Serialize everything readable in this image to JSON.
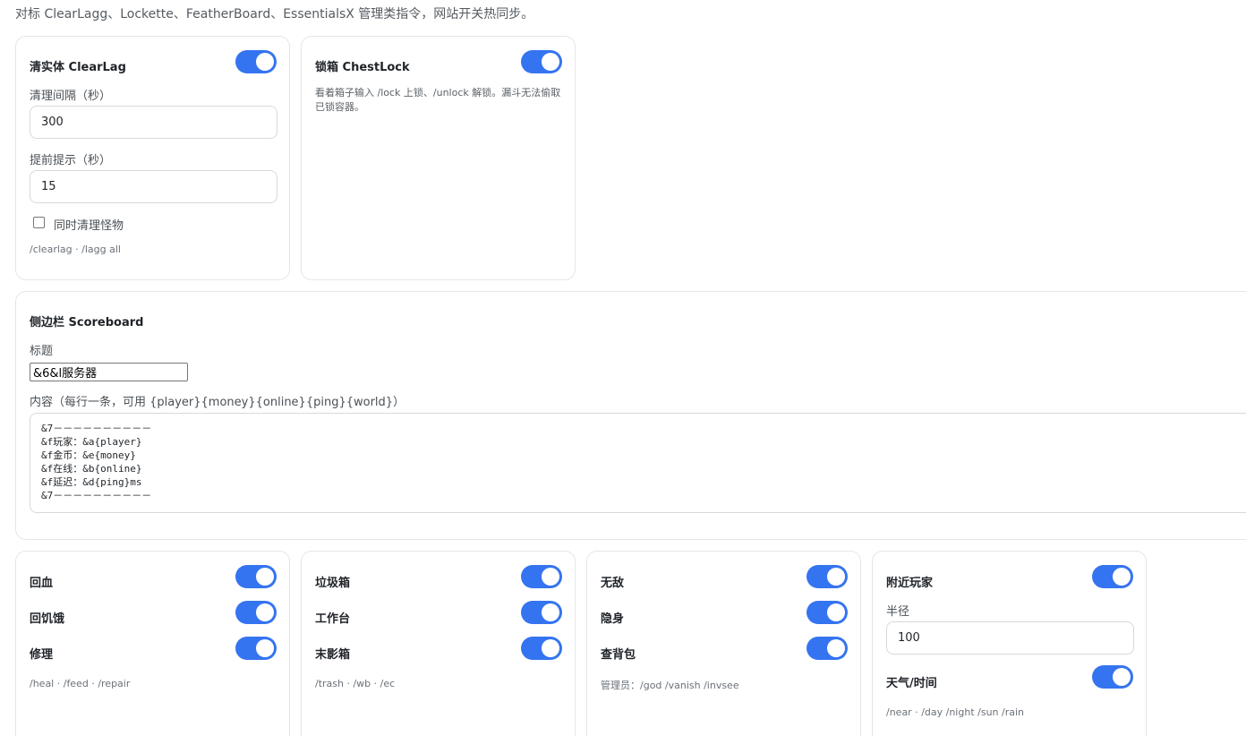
{
  "intro_text": "对标 ClearLagg、Lockette、FeatherBoard、EssentialsX 管理类指令，网站开关热同步。",
  "clearlag": {
    "title": "清实体 ClearLag",
    "enabled": true,
    "interval_label": "清理间隔（秒）",
    "interval_value": "300",
    "warn_label": "提前提示（秒）",
    "warn_value": "15",
    "monsters_label": "同时清理怪物",
    "monsters_checked": false,
    "commands": "/clearlag · /lagg all"
  },
  "chestlock": {
    "title": "锁箱 ChestLock",
    "enabled": true,
    "description": "看着箱子输入 /lock 上锁、/unlock 解锁。漏斗无法偷取已锁容器。"
  },
  "scoreboard": {
    "title": "侧边栏 Scoreboard",
    "title_label": "标题",
    "title_value": "&6&l服务器",
    "content_label": "内容（每行一条，可用 {player}{money}{online}{ping}{world}）",
    "content_lines": [
      "&7－－－－－－－－－－",
      "&f玩家：&a{player}",
      "&f金币：&e{money}",
      "&f在线：&b{online}",
      "&f延迟：&d{ping}ms",
      "&7－－－－－－－－－－"
    ]
  },
  "heal_card": {
    "items": [
      {
        "label": "回血",
        "enabled": true
      },
      {
        "label": "回饥饿",
        "enabled": true
      },
      {
        "label": "修理",
        "enabled": true
      }
    ],
    "commands": "/heal · /feed · /repair"
  },
  "utility_card": {
    "items": [
      {
        "label": "垃圾箱",
        "enabled": true
      },
      {
        "label": "工作台",
        "enabled": true
      },
      {
        "label": "末影箱",
        "enabled": true
      }
    ],
    "commands": "/trash · /wb · /ec"
  },
  "admin_card": {
    "items": [
      {
        "label": "无敌",
        "enabled": true
      },
      {
        "label": "隐身",
        "enabled": true
      },
      {
        "label": "查背包",
        "enabled": true
      }
    ],
    "commands": "管理员：/god /vanish /invsee"
  },
  "nearby_card": {
    "nearby_label": "附近玩家",
    "nearby_enabled": true,
    "radius_label": "半径",
    "radius_value": "100",
    "weather_label": "天气/时间",
    "weather_enabled": true,
    "commands": "/near · /day /night /sun /rain"
  },
  "colors": {
    "toggle_on": "#3574f0",
    "card_border": "#e3e6ea"
  }
}
